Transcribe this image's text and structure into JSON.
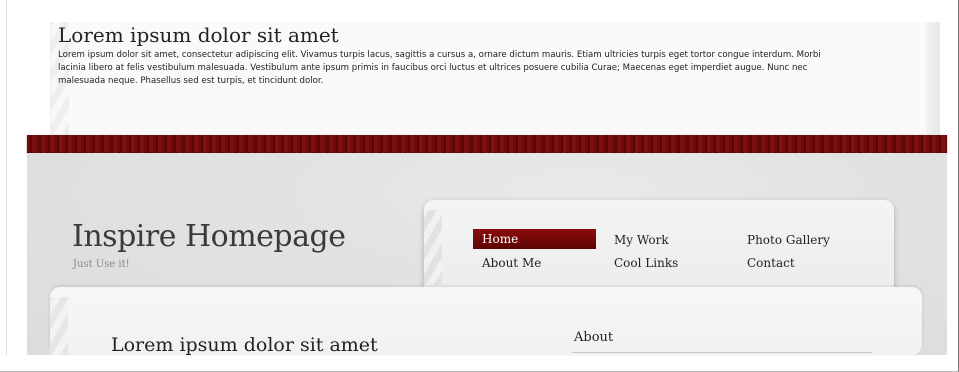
{
  "top_section": {
    "title": "Lorem ipsum dolor sit amet",
    "body": "Lorem ipsum dolor sit amet, consectetur adipiscing elit. Vivamus turpis lacus, sagittis a cursus a, ornare dictum mauris. Etiam ultricies turpis eget tortor congue interdum. Morbi lacinia libero at felis vestibulum malesuada. Vestibulum ante ipsum primis in faucibus orci luctus et ultrices posuere cubilia Curae; Maecenas eget imperdiet augue. Nunc nec malesuada neque. Phasellus sed est turpis, et tincidunt dolor."
  },
  "header": {
    "site_title": "Inspire Homepage",
    "tagline": "Just Use it!"
  },
  "nav": {
    "items": [
      {
        "label": "Home",
        "active": true
      },
      {
        "label": "My Work"
      },
      {
        "label": "Photo Gallery"
      },
      {
        "label": "About Me"
      },
      {
        "label": "Cool Links"
      },
      {
        "label": "Contact"
      }
    ]
  },
  "main": {
    "title": "Lorem ipsum dolor sit amet",
    "sidebar_heading": "About"
  },
  "colors": {
    "accent_red": "#7a0a0a",
    "background_grey": "#e2e2e2"
  }
}
